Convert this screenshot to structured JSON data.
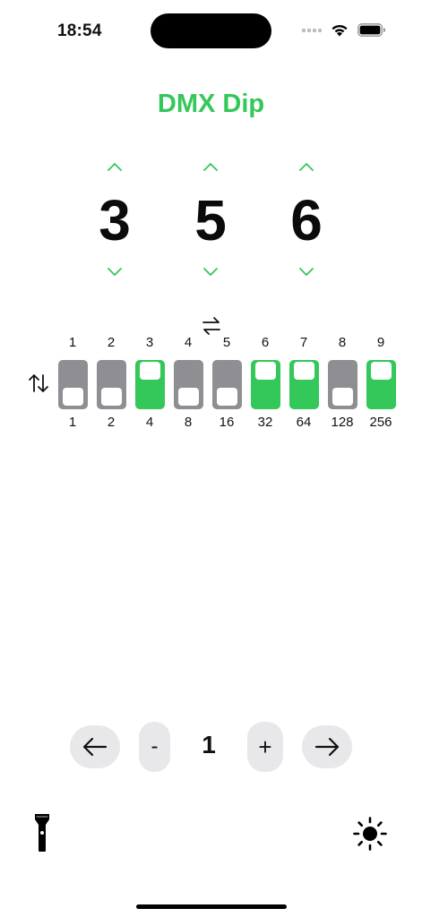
{
  "status_bar": {
    "time": "18:54"
  },
  "app": {
    "title": "DMX Dip",
    "accent_color": "#34c759",
    "off_color": "#8e8e93"
  },
  "digits": [
    {
      "value": "3"
    },
    {
      "value": "5"
    },
    {
      "value": "6"
    }
  ],
  "dip_switches": [
    {
      "position": "1",
      "weight": "1",
      "on": false
    },
    {
      "position": "2",
      "weight": "2",
      "on": false
    },
    {
      "position": "3",
      "weight": "4",
      "on": true
    },
    {
      "position": "4",
      "weight": "8",
      "on": false
    },
    {
      "position": "5",
      "weight": "16",
      "on": false
    },
    {
      "position": "6",
      "weight": "32",
      "on": true
    },
    {
      "position": "7",
      "weight": "64",
      "on": true
    },
    {
      "position": "8",
      "weight": "128",
      "on": false
    },
    {
      "position": "9",
      "weight": "256",
      "on": true
    }
  ],
  "nav": {
    "minus_label": "-",
    "plus_label": "+",
    "page": "1"
  },
  "icons": {
    "swap_horizontal": "arrow-left-right-icon",
    "swap_vertical": "arrow-up-down-icon",
    "flashlight": "flashlight-icon",
    "brightness": "sun-icon"
  }
}
